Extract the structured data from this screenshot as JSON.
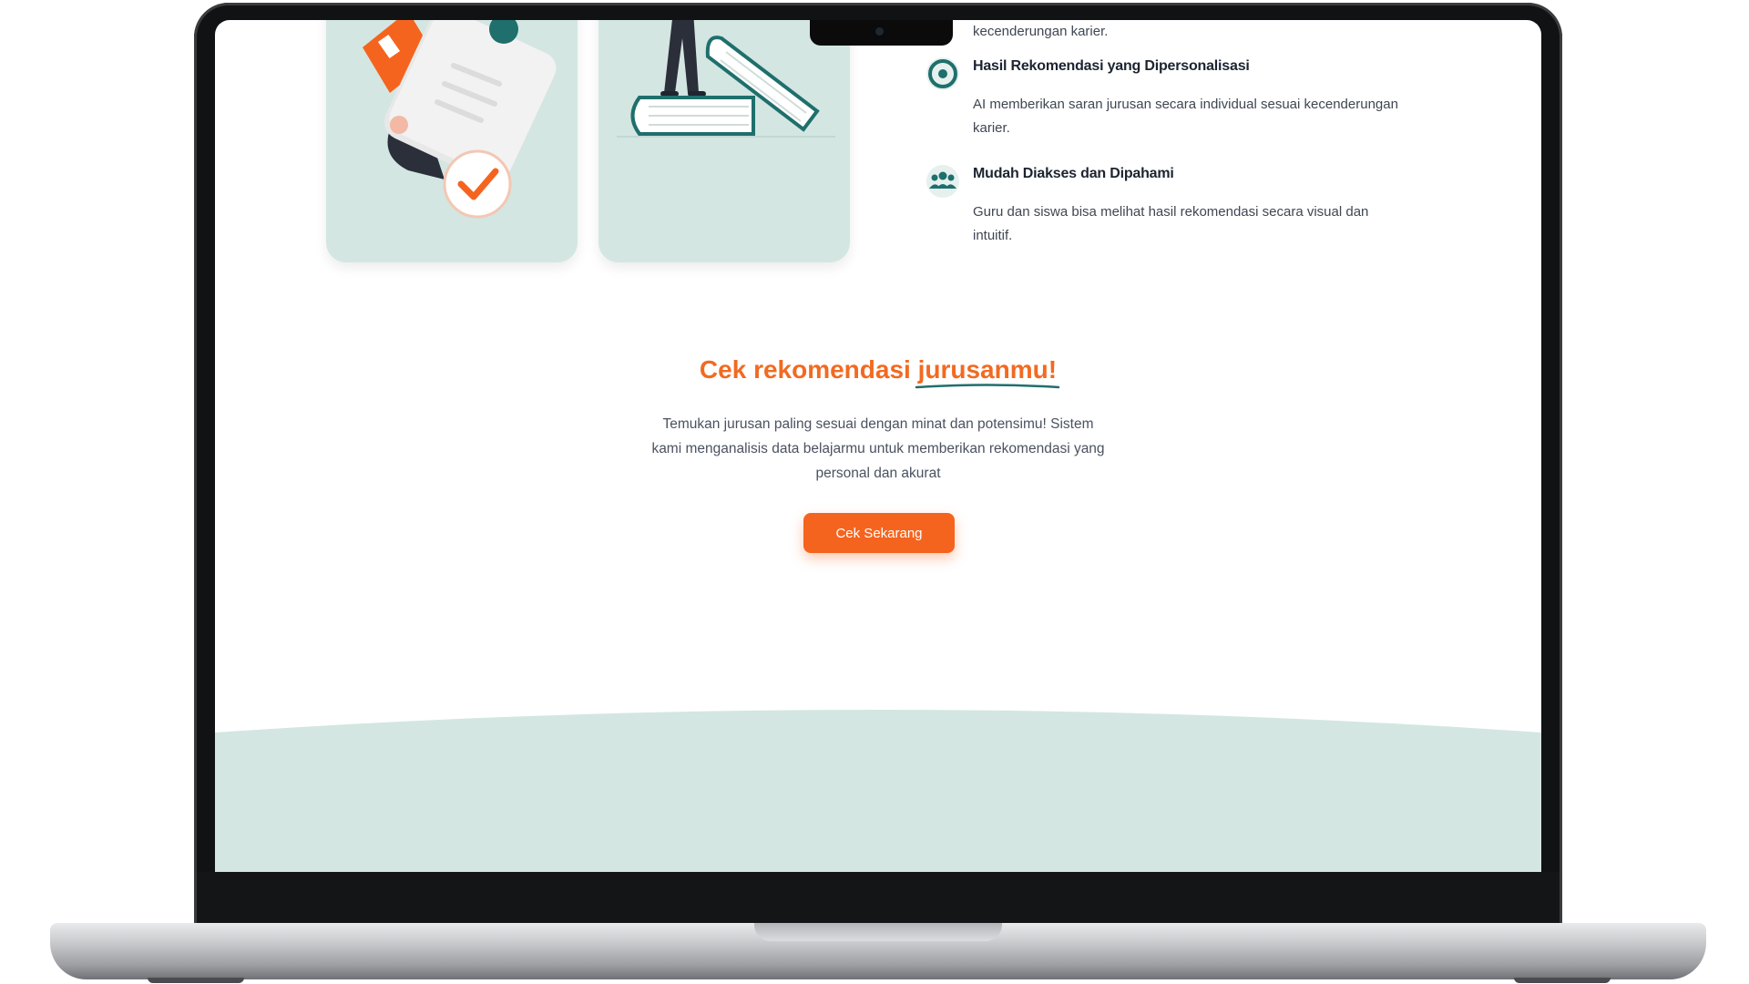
{
  "features": {
    "prev_desc_tail": "kecenderungan karier.",
    "items": [
      {
        "title": "Hasil Rekomendasi yang Dipersonalisasi",
        "desc": "AI memberikan saran jurusan secara individual sesuai kecenderungan karier.",
        "icon": "target-icon"
      },
      {
        "title": "Mudah Diakses dan Dipahami",
        "desc": "Guru dan siswa bisa melihat hasil rekomendasi secara visual dan intuitif.",
        "icon": "users-group-icon"
      }
    ]
  },
  "cta": {
    "title_prefix": "Cek rekomendasi ",
    "title_highlight": "jurusanmu!",
    "text": "Temukan jurusan paling sesuai dengan minat dan potensimu! Sistem kami menganalisis data belajarmu untuk memberikan rekomendasi yang personal dan akurat",
    "button_label": "Cek Sekarang"
  },
  "colors": {
    "accent": "#f26a21",
    "teal": "#1f6f6c",
    "card_bg": "#d3e6e2",
    "footer_bg": "#d3e6e2"
  }
}
